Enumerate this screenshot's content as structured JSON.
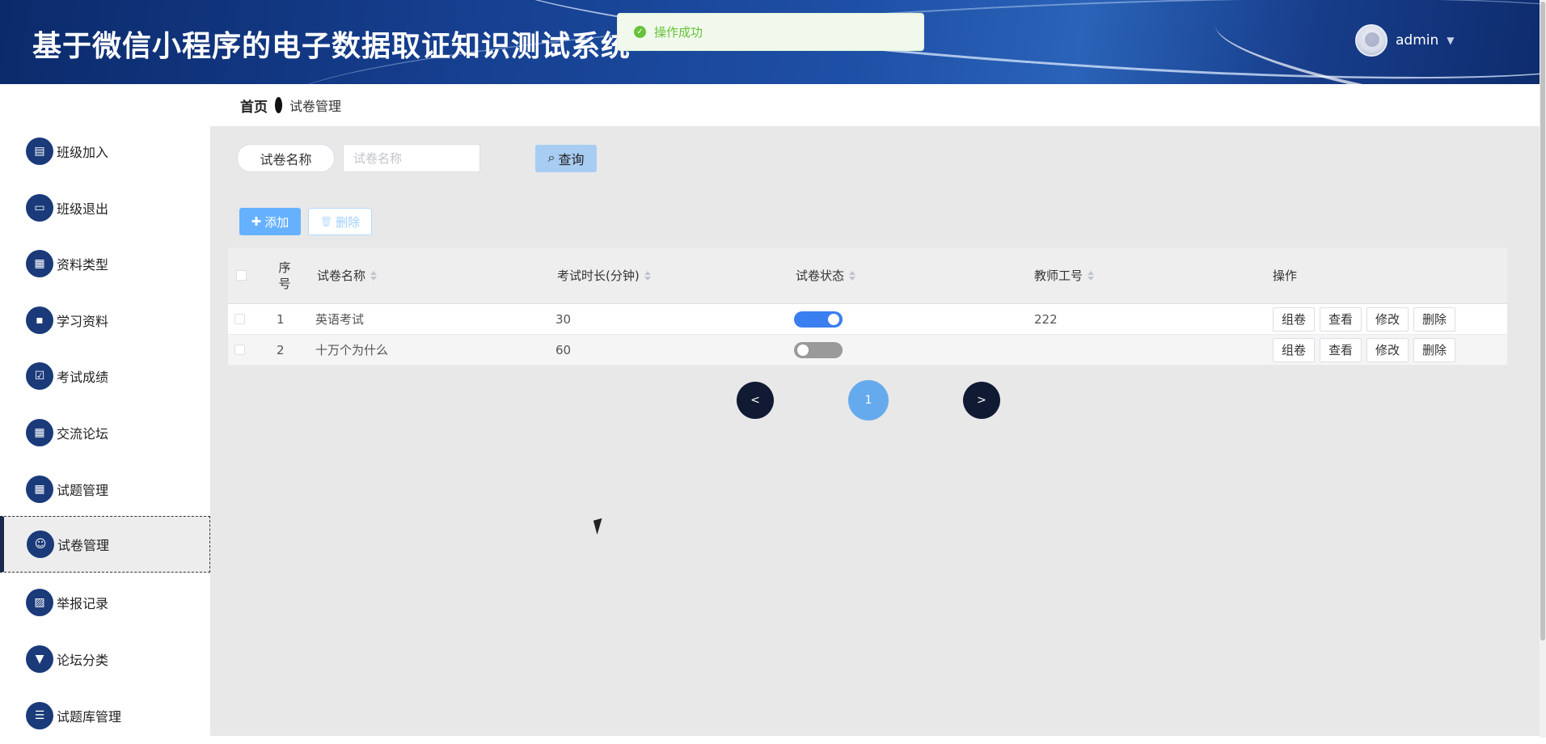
{
  "header": {
    "title": "基于微信小程序的电子数据取证知识测试系统",
    "user_name": "admin",
    "caret": "▼"
  },
  "toast": {
    "message": "操作成功",
    "icon": "✓"
  },
  "sidebar": {
    "items": [
      {
        "label": "班级加入",
        "icon": "▤"
      },
      {
        "label": "班级退出",
        "icon": "▭"
      },
      {
        "label": "资料类型",
        "icon": "▦"
      },
      {
        "label": "学习资料",
        "icon": "▪"
      },
      {
        "label": "考试成绩",
        "icon": "☑"
      },
      {
        "label": "交流论坛",
        "icon": "▦"
      },
      {
        "label": "试题管理",
        "icon": "▦"
      },
      {
        "label": "试卷管理",
        "icon": "☺"
      },
      {
        "label": "举报记录",
        "icon": "▨"
      },
      {
        "label": "论坛分类",
        "icon": "▼"
      },
      {
        "label": "试题库管理",
        "icon": "☰"
      }
    ]
  },
  "breadcrumb": {
    "home": "首页",
    "current": "试卷管理"
  },
  "search": {
    "label": "试卷名称",
    "placeholder": "试卷名称",
    "query_label": "查询",
    "query_icon": "⌕"
  },
  "toolbar": {
    "add_label": "添加",
    "add_icon": "✚",
    "delete_label": "删除",
    "delete_icon": "🗑"
  },
  "table": {
    "headers": {
      "index": "序号",
      "name": "试卷名称",
      "duration": "考试时长(分钟)",
      "status": "试卷状态",
      "teacher": "教师工号",
      "ops": "操作"
    },
    "rows": [
      {
        "index": "1",
        "name": "英语考试",
        "duration": "30",
        "status_on": true,
        "teacher": "222"
      },
      {
        "index": "2",
        "name": "十万个为什么",
        "duration": "60",
        "status_on": false,
        "teacher": ""
      }
    ],
    "row_actions": [
      "组卷",
      "查看",
      "修改",
      "删除"
    ]
  },
  "pagination": {
    "prev": "<",
    "current": "1",
    "next": ">"
  }
}
